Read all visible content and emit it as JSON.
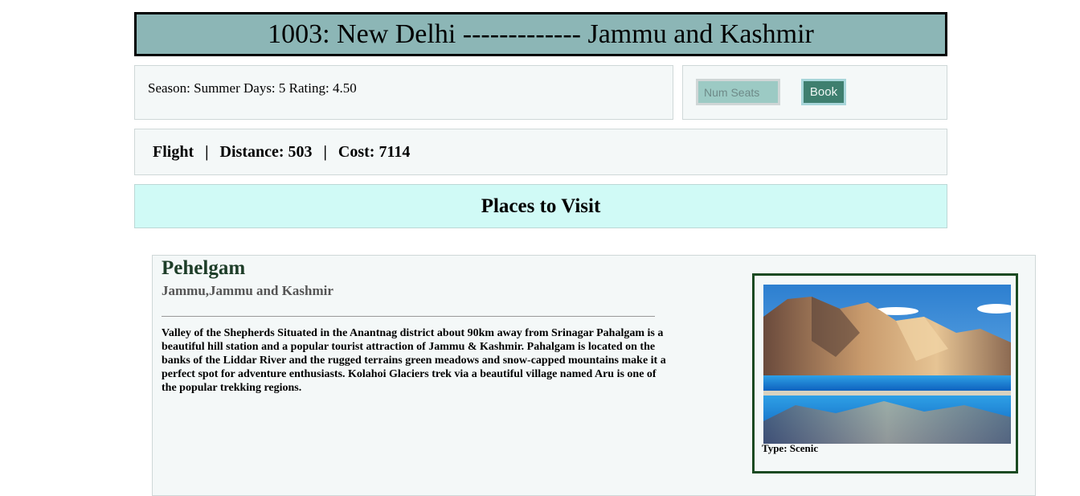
{
  "route": {
    "title": "1003: New Delhi ------------- Jammu and Kashmir"
  },
  "info": {
    "summary": "Season: Summer Days: 5 Rating: 4.50"
  },
  "booking": {
    "seats_placeholder": "Num Seats",
    "seats_value": "",
    "book_label": "Book"
  },
  "travel": {
    "mode": "Flight",
    "separator": "|",
    "distance": "Distance: 503",
    "cost": "Cost: 7114"
  },
  "places_header": "Places to Visit",
  "place": {
    "name": "Pehelgam",
    "location": "Jammu,Jammu and Kashmir",
    "description": "Valley of the Shepherds Situated in the Anantnag district about 90km away from Srinagar Pahalgam is a beautiful hill station and a popular tourist attraction of Jammu & Kashmir. Pahalgam is located on the banks of the Liddar River and the rugged terrains green meadows and snow-capped mountains make it a perfect spot for adventure enthusiasts. Kolahoi Glaciers trek via a beautiful village named Aru is one of the popular trekking regions.",
    "type": "Type: Scenic"
  },
  "colors": {
    "title_bg": "#8cb6b6",
    "places_header_bg": "#d0faf6",
    "book_button_bg": "#3f7f6f",
    "place_name": "#1d3d28",
    "image_frame_border": "#1b4a22"
  }
}
